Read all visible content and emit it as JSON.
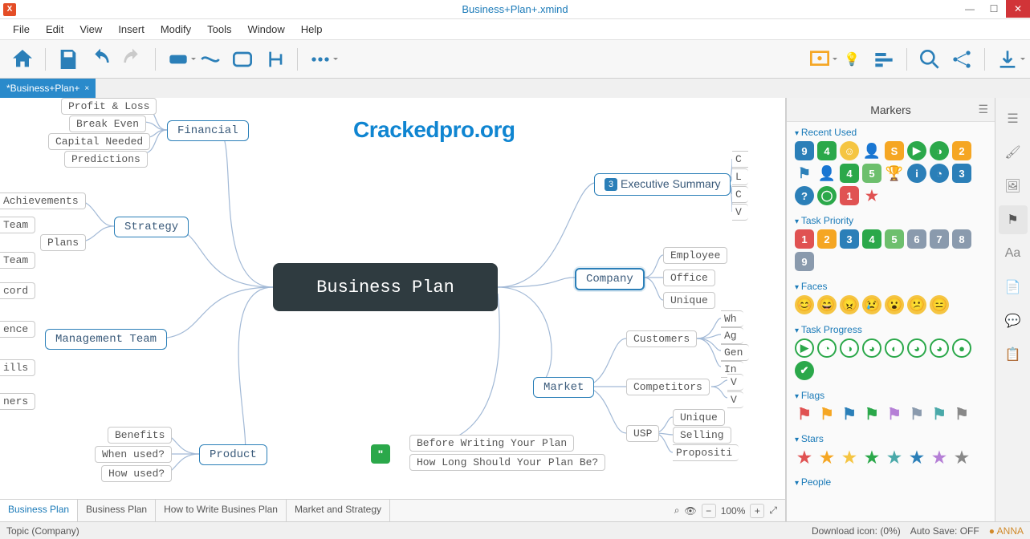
{
  "window": {
    "title": "Business+Plan+.xmind",
    "app_icon_letter": "X"
  },
  "menus": [
    "File",
    "Edit",
    "View",
    "Insert",
    "Modify",
    "Tools",
    "Window",
    "Help"
  ],
  "file_tab": {
    "label": "*Business+Plan+",
    "close": "×"
  },
  "watermark": "Crackedpro.org",
  "central_topic": "Business Plan",
  "nodes": {
    "financial": "Financial",
    "strategy": "Strategy",
    "management": "Management Team",
    "product": "Product",
    "exec_summary": "Executive Summary",
    "company": "Company",
    "market": "Market"
  },
  "exec_marker": "3",
  "leaves": {
    "financial": [
      "Profit & Loss",
      "Break Even",
      "Capital Needed",
      "Predictions"
    ],
    "strategy_above": "Achievements",
    "strategy_plans": "Plans",
    "strategy_left": [
      "Team",
      "Team"
    ],
    "management_left": [
      "cord",
      "ence",
      "ills",
      "ners"
    ],
    "product": [
      "Benefits",
      "When used?",
      "How used?"
    ],
    "exec_right": [
      "C",
      "L",
      "C",
      "V"
    ],
    "company": [
      "Employee",
      "Office",
      "Unique"
    ],
    "market_customers": "Customers",
    "market_competitors": "Competitors",
    "market_usp": "USP",
    "market_cust_sub": [
      "Wh",
      "Ag",
      "Gen",
      "In"
    ],
    "market_comp_sub": [
      "V",
      "V"
    ],
    "market_usp_sub": [
      "Unique",
      "Selling",
      "Propositi"
    ],
    "notes": [
      "Before Writing Your Plan",
      "How Long Should Your Plan Be?"
    ]
  },
  "canvas_tabs": [
    "Business Plan",
    "Business Plan",
    "How to Write Busines Plan",
    "Market and Strategy"
  ],
  "zoom": {
    "value": "100%"
  },
  "markers_panel": {
    "title": "Markers",
    "sections": {
      "recent": "Recent Used",
      "priority": "Task Priority",
      "faces": "Faces",
      "progress": "Task Progress",
      "flags": "Flags",
      "stars": "Stars",
      "people": "People"
    },
    "recent_items": [
      {
        "t": "9",
        "bg": "#2b7fb8"
      },
      {
        "t": "4",
        "bg": "#2ba84a"
      },
      {
        "t": "☺",
        "bg": "#f5c542",
        "round": true
      },
      {
        "t": "👤",
        "bg": "#5b72a6",
        "plain": true
      },
      {
        "t": "S",
        "bg": "#f5a623"
      },
      {
        "t": "▶",
        "bg": "#2ba84a",
        "round": true
      },
      {
        "t": "◑",
        "bg": "#2ba84a",
        "round": true
      },
      {
        "t": "2",
        "bg": "#f5a623"
      },
      {
        "t": "⚑",
        "bg": "#2b7fb8",
        "plain": true
      },
      {
        "t": "👤",
        "bg": "#2b7fb8",
        "plain": true
      },
      {
        "t": "4",
        "bg": "#2ba84a"
      },
      {
        "t": "5",
        "bg": "#6dbf6d"
      },
      {
        "t": "🏆",
        "bg": "#f5c542",
        "plain": true
      },
      {
        "t": "i",
        "bg": "#2b7fb8",
        "round": true
      },
      {
        "t": "◔",
        "bg": "#2b7fb8",
        "round": true
      },
      {
        "t": "3",
        "bg": "#2b7fb8"
      },
      {
        "t": "?",
        "bg": "#2b7fb8",
        "round": true
      },
      {
        "t": "◯",
        "bg": "#2ba84a",
        "round": true
      },
      {
        "t": "1",
        "bg": "#e05252"
      },
      {
        "t": "★",
        "bg": "#e05252",
        "plain": true
      }
    ],
    "priority_items": [
      {
        "t": "1",
        "bg": "#e05252"
      },
      {
        "t": "2",
        "bg": "#f5a623"
      },
      {
        "t": "3",
        "bg": "#2b7fb8"
      },
      {
        "t": "4",
        "bg": "#2ba84a"
      },
      {
        "t": "5",
        "bg": "#6dbf6d"
      },
      {
        "t": "6",
        "bg": "#8a9aad"
      },
      {
        "t": "7",
        "bg": "#8a9aad"
      },
      {
        "t": "8",
        "bg": "#8a9aad"
      },
      {
        "t": "9",
        "bg": "#8a9aad"
      }
    ],
    "faces": [
      "😊",
      "😄",
      "😠",
      "😢",
      "😮",
      "😕",
      "😑"
    ],
    "progress_colors": [
      "#2ba84a",
      "#2ba84a",
      "#2ba84a",
      "#2ba84a",
      "#2ba84a",
      "#2ba84a",
      "#2ba84a",
      "#2ba84a",
      "#2ba84a"
    ],
    "flag_colors": [
      "#e05252",
      "#f5a623",
      "#2b7fb8",
      "#2ba84a",
      "#b57fd6",
      "#8a9aad",
      "#4aa9a9",
      "#888"
    ],
    "star_colors": [
      "#e05252",
      "#f5a623",
      "#f5c542",
      "#2ba84a",
      "#4aa9a9",
      "#2b7fb8",
      "#b57fd6",
      "#888"
    ]
  },
  "statusbar": {
    "topic": "Topic (Company)",
    "download": "Download icon: (0%)",
    "autosave": "Auto Save: OFF",
    "user": "● ANNA"
  }
}
